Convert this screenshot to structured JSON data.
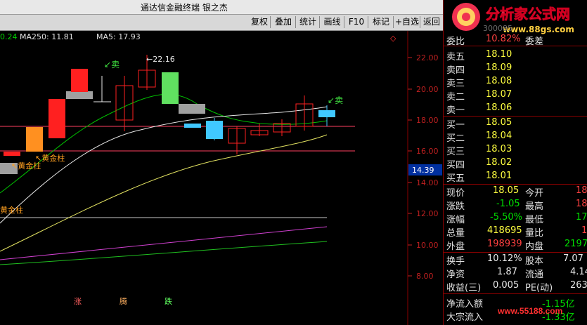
{
  "window": {
    "title": "通达信金融终端 银之杰"
  },
  "toolbar": {
    "buttons": [
      "复权",
      "叠加",
      "统计",
      "画线",
      "F10",
      "标记",
      "+自选",
      "返回"
    ]
  },
  "indicators": {
    "ma_left": "0.24",
    "ma250": "MA250: 11.81",
    "ma5": "MA5: 17.93"
  },
  "price_axis": [
    "22.00",
    "20.00",
    "18.00",
    "16.00",
    "14.00",
    "12.00",
    "10.00",
    "8.00"
  ],
  "current_price_tag": "14.39",
  "annotations": {
    "sell_1": "卖",
    "sell_2": "卖",
    "high_label": "22.16",
    "gold_1": "黄金柱",
    "gold_2": "黄金柱",
    "gold_3": "黄金柱"
  },
  "bottom_markers": {
    "m1": "涨",
    "m2": "腾",
    "m3": "跌"
  },
  "watermark": {
    "top": "分析家公式网",
    "url_top": "www.88gs.com",
    "url_bottom": "www.55188.com",
    "code": "300085"
  },
  "quote": {
    "ratio_label": "委比",
    "ratio_value": "10.82%",
    "diff_label": "委差",
    "sells": [
      {
        "label": "卖五",
        "price": "18.10"
      },
      {
        "label": "卖四",
        "price": "18.09"
      },
      {
        "label": "卖三",
        "price": "18.08"
      },
      {
        "label": "卖二",
        "price": "18.07"
      },
      {
        "label": "卖一",
        "price": "18.06"
      }
    ],
    "buys": [
      {
        "label": "买一",
        "price": "18.05"
      },
      {
        "label": "买二",
        "price": "18.04"
      },
      {
        "label": "买三",
        "price": "18.03"
      },
      {
        "label": "买四",
        "price": "18.02"
      },
      {
        "label": "买五",
        "price": "18.01"
      }
    ],
    "stats": {
      "now_label": "现价",
      "now": "18.05",
      "open_label": "今开",
      "open": "18",
      "chg_label": "涨跌",
      "chg": "-1.05",
      "high_label": "最高",
      "high": "18",
      "pct_label": "涨幅",
      "pct": "-5.50%",
      "low_label": "最低",
      "low": "17",
      "vol_label": "总量",
      "vol": "418695",
      "vr_label": "量比",
      "vr": "1",
      "outer_label": "外盘",
      "outer": "198939",
      "inner_label": "内盘",
      "inner": "2197",
      "turn_label": "换手",
      "turn": "10.12%",
      "cap_label": "股本",
      "cap": "7.07",
      "nav_label": "净资",
      "nav": "1.87",
      "float_label": "流通",
      "float": "4.14",
      "eps_label": "收益(三)",
      "eps": "0.005",
      "pe_label": "PE(动)",
      "pe": "263",
      "netin_label": "净流入额",
      "netin": "-1.15亿",
      "big_label": "大宗流入",
      "big": "-1.33亿"
    }
  }
}
